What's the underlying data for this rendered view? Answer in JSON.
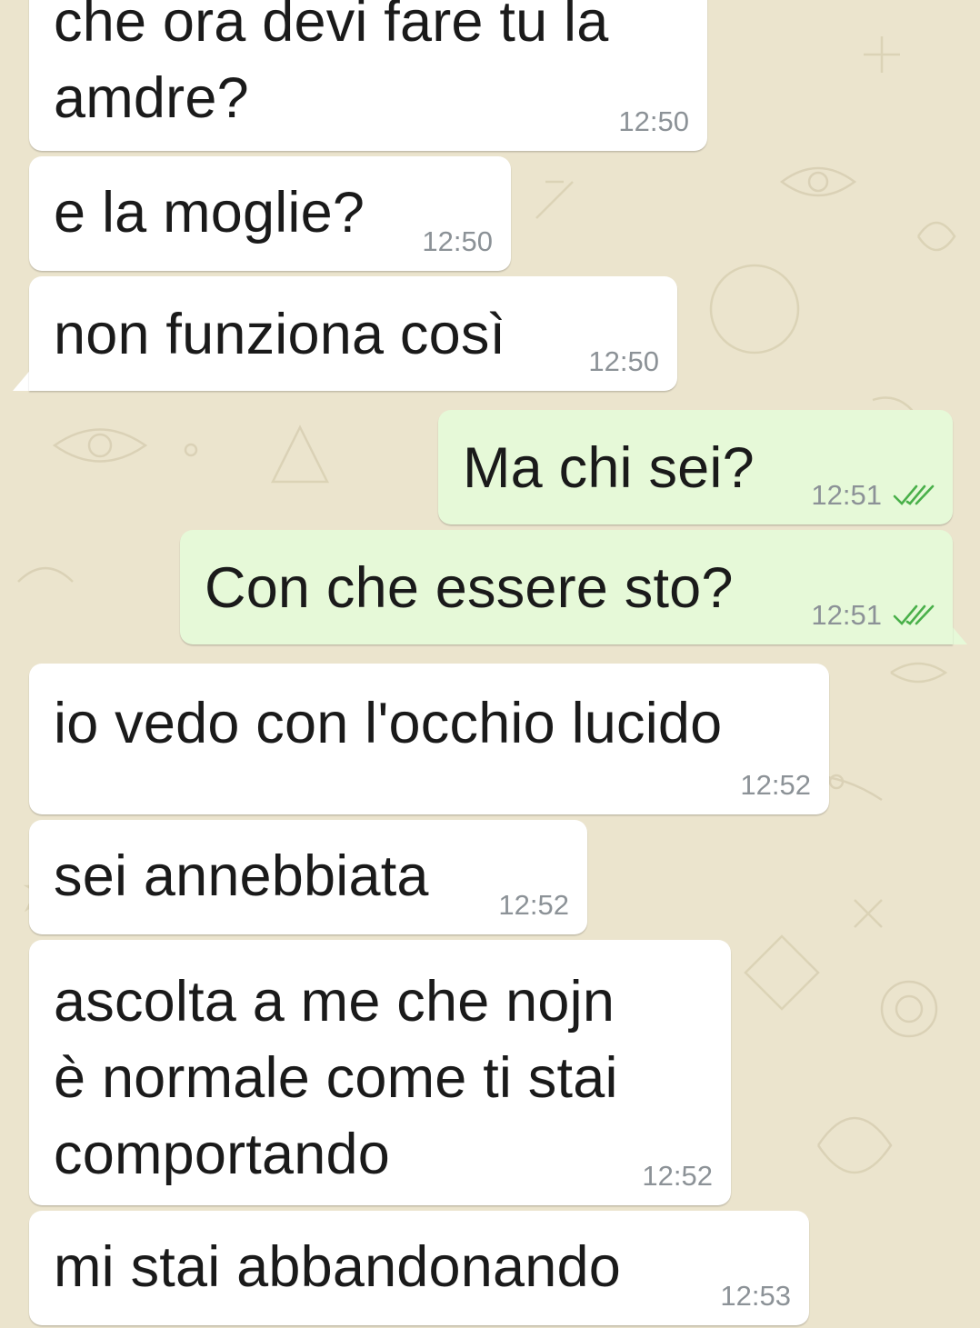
{
  "chat": {
    "wallpaper_color": "#ebe4cd",
    "incoming_bubble_color": "#ffffff",
    "outgoing_bubble_color": "#e6f9d8",
    "read_receipt_color": "#4fc3f7",
    "messages": [
      {
        "direction": "in",
        "text": "che ora devi fare tu la\namdre?",
        "time": "12:50"
      },
      {
        "direction": "in",
        "text": "e la moglie?",
        "time": "12:50"
      },
      {
        "direction": "in",
        "text": "non funziona così",
        "time": "12:50"
      },
      {
        "direction": "out",
        "text": "Ma chi sei?",
        "time": "12:51",
        "status": "read-double-check-icon"
      },
      {
        "direction": "out",
        "text": "Con che essere sto?",
        "time": "12:51",
        "status": "read-double-check-icon"
      },
      {
        "direction": "in",
        "text": "io vedo con l'occhio lucido",
        "time": "12:52"
      },
      {
        "direction": "in",
        "text": "sei annebbiata",
        "time": "12:52"
      },
      {
        "direction": "in",
        "text": "ascolta a me che nojn\nè normale come ti stai\ncomportando",
        "time": "12:52"
      },
      {
        "direction": "in",
        "text": "mi stai abbandonando",
        "time": "12:53"
      }
    ]
  }
}
